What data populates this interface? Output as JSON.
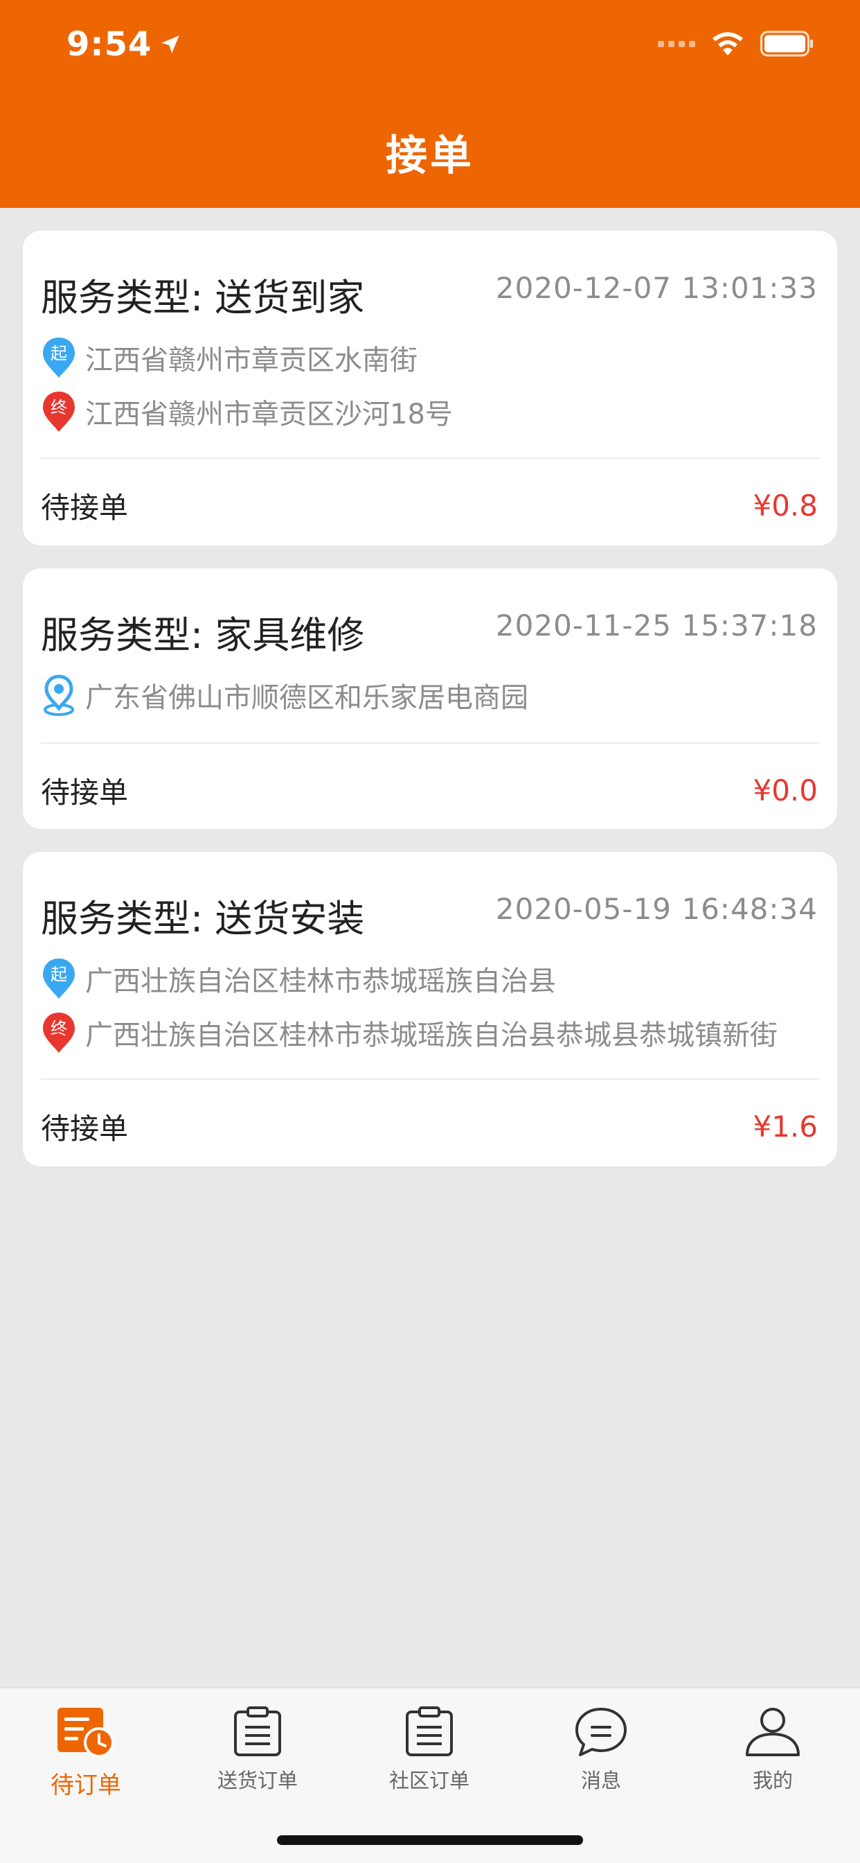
{
  "status_bar": {
    "time": "9:54"
  },
  "header": {
    "title": "接单"
  },
  "orders": [
    {
      "service_type": "服务类型: 送货到家",
      "timestamp": "2020-12-07 13:01:33",
      "start_badge": "起",
      "start_address": "江西省赣州市章贡区水南街",
      "end_badge": "终",
      "end_address": "江西省赣州市章贡区沙河18号",
      "status": "待接单",
      "price": "¥0.8"
    },
    {
      "service_type": "服务类型: 家具维修",
      "timestamp": "2020-11-25 15:37:18",
      "address": "广东省佛山市顺德区和乐家居电商园",
      "status": "待接单",
      "price": "¥0.0"
    },
    {
      "service_type": "服务类型: 送货安装",
      "timestamp": "2020-05-19 16:48:34",
      "start_badge": "起",
      "start_address": "广西壮族自治区桂林市恭城瑶族自治县",
      "end_badge": "终",
      "end_address": "广西壮族自治区桂林市恭城瑶族自治县恭城县恭城镇新街",
      "status": "待接单",
      "price": "¥1.6"
    }
  ],
  "tabbar": {
    "items": [
      {
        "label": "待订单",
        "icon": "pending-orders-icon",
        "active": true
      },
      {
        "label": "送货订单",
        "icon": "delivery-orders-icon"
      },
      {
        "label": "社区订单",
        "icon": "community-orders-icon"
      },
      {
        "label": "消息",
        "icon": "messages-icon"
      },
      {
        "label": "我的",
        "icon": "profile-icon"
      }
    ]
  },
  "colors": {
    "brand": "#ee6603",
    "price": "#e8372f",
    "start_pin": "#3aa8f0",
    "end_pin": "#e8372f"
  }
}
